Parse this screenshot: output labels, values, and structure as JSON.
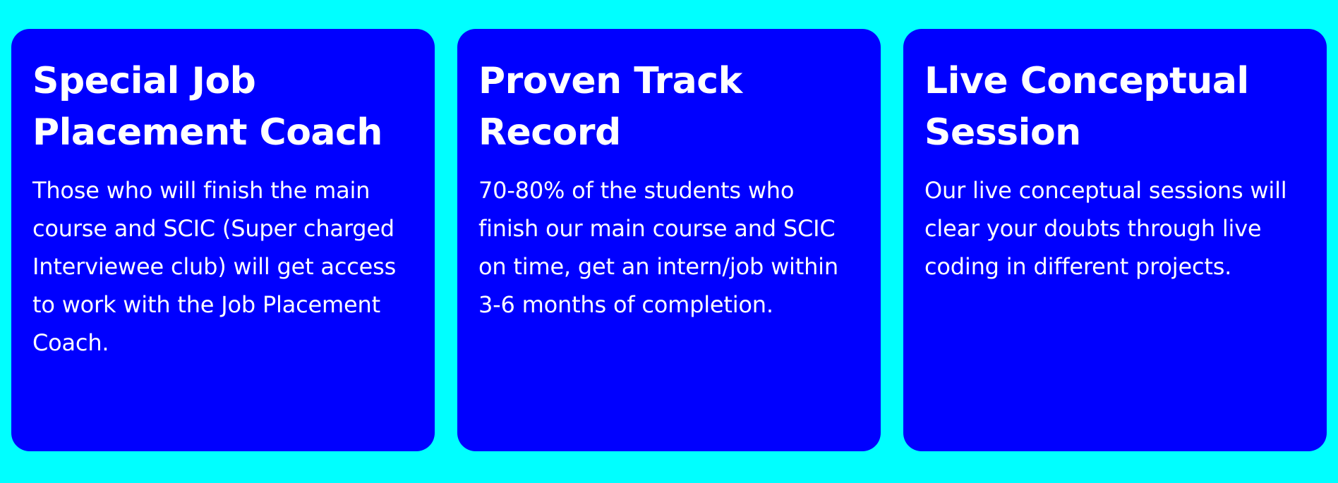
{
  "colors": {
    "page_background": "#00ffff",
    "card_background": "#0000ff",
    "text": "#ffffff"
  },
  "cards": [
    {
      "title": "Special Job Placement Coach",
      "text": "Those who will finish the main course and SCIC (Super charged Interviewee club) will get access to work with the Job Placement Coach."
    },
    {
      "title": "Proven Track Record",
      "text": "70-80% of the students who finish our main course and SCIC on time, get an intern/job within 3-6 months of completion."
    },
    {
      "title": "Live Conceptual Session",
      "text": "Our live conceptual sessions will clear your doubts through live coding in different projects."
    }
  ]
}
